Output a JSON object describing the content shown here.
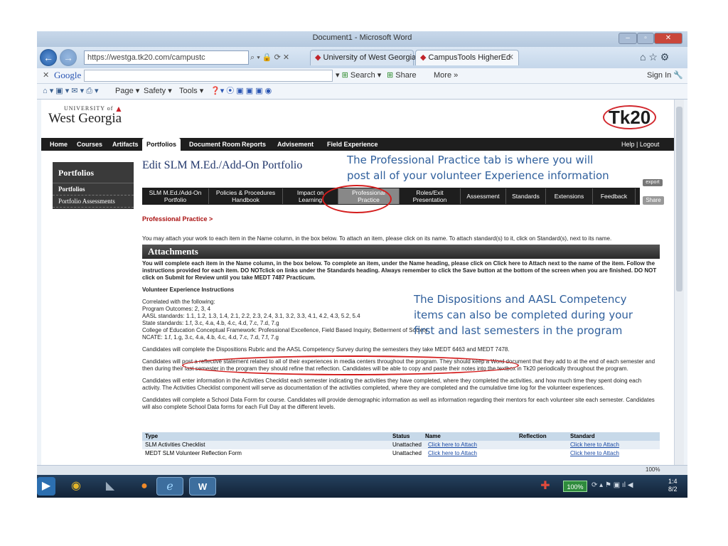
{
  "window": {
    "title": "Document1 - Microsoft Word"
  },
  "browser": {
    "url": "https://westga.tk20.com/campustc",
    "tabs": [
      {
        "label": "University of West Georgia"
      },
      {
        "label": "CampusTools HigherEd"
      }
    ],
    "google_bar": {
      "logo": "Google",
      "search": "Search",
      "share": "Share",
      "more": "More »",
      "sign_in": "Sign In"
    },
    "command_bar": {
      "page": "Page",
      "safety": "Safety",
      "tools": "Tools"
    }
  },
  "site": {
    "university_small": "UNIVERSITY of",
    "university": "West Georgia",
    "tk20": "Tk20",
    "help": "Help",
    "logout": "Logout",
    "main_nav": [
      "Home",
      "Courses",
      "Artifacts",
      "Portfolios",
      "Document Room",
      "Reports",
      "Advisement",
      "Field Experience"
    ]
  },
  "sidebar": {
    "title": "Portfolios",
    "items": [
      "Portfolios",
      "Portfolio Assessments"
    ]
  },
  "content": {
    "title": "Edit SLM M.Ed./Add-On Portfolio",
    "export": "export",
    "share": "Share",
    "subtabs": [
      {
        "l1": "SLM M.Ed./Add-On",
        "l2": "Portfolio"
      },
      {
        "l1": "Policies & Procedures",
        "l2": "Handbook"
      },
      {
        "l1": "Impact on",
        "l2": "Learning"
      },
      {
        "l1": "Professional",
        "l2": "Practice"
      },
      {
        "l1": "Roles/Exit",
        "l2": "Presentation"
      },
      {
        "l1": "Assessment",
        "l2": ""
      },
      {
        "l1": "Standards",
        "l2": ""
      },
      {
        "l1": "Extensions",
        "l2": ""
      },
      {
        "l1": "Feedback",
        "l2": ""
      }
    ],
    "breadcrumb": "Professional Practice >",
    "hint": "You may attach your work to each item in the Name column, in the box below. To attach an item, please click on its name. To attach standard(s) to it, click on Standard(s), next to its name.",
    "attachments_title": "Attachments",
    "intro": "You will complete each item in the Name column, in the box below. To complete an item, under the Name heading, please click on Click here to Attach next to the name of the item. Follow the instructions provided for each item. DO NOTclick on links under the Standards heading. Always remember to click the Save button at the bottom of the screen when you are finished. DO NOT click on Submit for Review until you take MEDT 7487 Practicum.",
    "vol_title": "Volunteer Experience Instructions",
    "correlated": [
      "Correlated with the following:",
      "Program Outcomes: 2, 3, 4",
      "AASL standards: 1.1, 1.2, 1.3, 1.4, 2.1, 2.2, 2.3, 2.4, 3.1, 3.2, 3.3, 4.1, 4.2, 4.3, 5.2, 5.4",
      "State standards: 1.f, 3.c, 4.a, 4.b, 4.c, 4.d, 7.c, 7.d, 7.g",
      "College of Education Conceptual Framework: Professional Excellence, Field Based Inquiry, Betterment of Society",
      "NCATE: 1.f, 1.g, 3.c, 4.a, 4.b, 4.c, 4.d, 7.c, 7.d, 7.f, 7.g"
    ],
    "p1": "Candidates will complete the Dispositions Rubric and the AASL Competency Survey during the semesters they take MEDT 6463 and MEDT 7478.",
    "p2": "Candidates will post a reflective statement related to all of their experiences in media centers throughout the program. They should keep a Word document that they add to at the end of each semester and then during their last semester in the program they should refine that reflection. Candidates will be able to copy and paste their notes into the textbox in Tk20 periodically throughout the program.",
    "p3": "Candidates will enter information in the Activities Checklist each semester indicating the activities they have completed, where they completed the activities, and how much time they spent doing each activity. The Activities Checklist component will serve as documentation of the activities completed, where they are completed and the cumulative time log for the volunteer experiences.",
    "p4": "Candidates will complete a School Data Form for course. Candidates will provide demographic information as well as information regarding their mentors for each volunteer site each semester. Candidates will also complete School Data forms for each Full Day at the different levels.",
    "table": {
      "headers": [
        "Type",
        "Status",
        "Name",
        "Reflection",
        "Standard"
      ],
      "rows": [
        {
          "type": "SLM Activities Checklist",
          "status": "Unattached",
          "name": "Click here to Attach",
          "standard": "Click here to Attach"
        },
        {
          "type": "MEDT SLM Volunteer Reflection Form",
          "status": "Unattached",
          "name": "Click here to Attach",
          "standard": "Click here to Attach"
        }
      ]
    }
  },
  "annotations": {
    "a1": [
      "The Professional Practice tab is where you will",
      "post all of your volunteer Experience information"
    ],
    "a2": [
      "The Dispositions and AASL Competency",
      "items can also be completed during your",
      "first and last semesters in the program"
    ]
  },
  "status_bar": {
    "zoom": "100%"
  },
  "taskbar": {
    "battery": "100%",
    "time": "1:4",
    "date": "8/2"
  }
}
